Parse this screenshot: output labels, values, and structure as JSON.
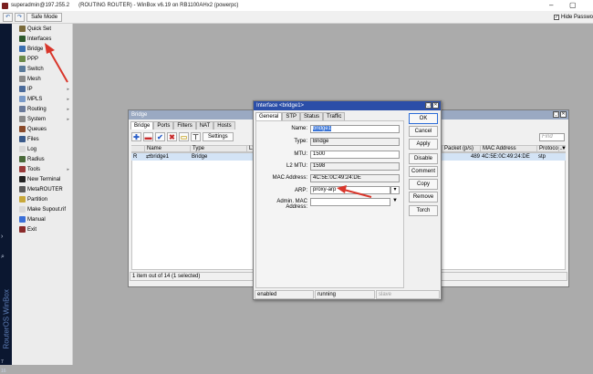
{
  "window": {
    "title": "superadmin@197.255.2      (ROUTING ROUTER) - WinBox v6.19 on RB1100AHx2 (powerpc)",
    "minimize_glyph": "–",
    "restore_glyph": "▢"
  },
  "toolbar": {
    "undo_label": "↶",
    "redo_label": "↷",
    "safe_mode_label": "Safe Mode",
    "hide_passwords_label": "Hide Passwo",
    "hide_passwords_checked": true,
    "check_mark": "✓"
  },
  "taskbar": {
    "brand": "RouterOS WinBox",
    "icons": [
      "›",
      "⌕",
      "Ps",
      "ε",
      "▤"
    ],
    "clock": [
      "7",
      "16"
    ]
  },
  "sidebar": {
    "items": [
      {
        "label": "Quick Set",
        "icon": "quick-set-icon",
        "color": "#7a6a3a",
        "arrow": ""
      },
      {
        "label": "Interfaces",
        "icon": "interfaces-icon",
        "color": "#2d5a2d",
        "arrow": ""
      },
      {
        "label": "Bridge",
        "icon": "bridge-icon",
        "color": "#3a6fb0",
        "arrow": ""
      },
      {
        "label": "PPP",
        "icon": "ppp-icon",
        "color": "#6a8a4a",
        "arrow": ""
      },
      {
        "label": "Switch",
        "icon": "switch-icon",
        "color": "#5a7a9a",
        "arrow": ""
      },
      {
        "label": "Mesh",
        "icon": "mesh-icon",
        "color": "#8a8a8a",
        "arrow": ""
      },
      {
        "label": "IP",
        "icon": "ip-icon",
        "color": "#4a6a9a",
        "arrow": "▸"
      },
      {
        "label": "MPLS",
        "icon": "mpls-icon",
        "color": "#7a9ac8",
        "arrow": "▸"
      },
      {
        "label": "Routing",
        "icon": "routing-icon",
        "color": "#6a7a9a",
        "arrow": "▸"
      },
      {
        "label": "System",
        "icon": "system-icon",
        "color": "#8a8a8a",
        "arrow": "▸"
      },
      {
        "label": "Queues",
        "icon": "queues-icon",
        "color": "#8a4a2a",
        "arrow": ""
      },
      {
        "label": "Files",
        "icon": "files-icon",
        "color": "#3a5a8a",
        "arrow": ""
      },
      {
        "label": "Log",
        "icon": "log-icon",
        "color": "#d8d8d8",
        "arrow": ""
      },
      {
        "label": "Radius",
        "icon": "radius-icon",
        "color": "#4a6a3a",
        "arrow": ""
      },
      {
        "label": "Tools",
        "icon": "tools-icon",
        "color": "#9a3a3a",
        "arrow": "▸"
      },
      {
        "label": "New Terminal",
        "icon": "terminal-icon",
        "color": "#222222",
        "arrow": ""
      },
      {
        "label": "MetaROUTER",
        "icon": "metarouter-icon",
        "color": "#5a5a5a",
        "arrow": ""
      },
      {
        "label": "Partition",
        "icon": "partition-icon",
        "color": "#c8a83a",
        "arrow": ""
      },
      {
        "label": "Make Supout.rif",
        "icon": "supout-icon",
        "color": "#d8d8d8",
        "arrow": ""
      },
      {
        "label": "Manual",
        "icon": "manual-icon",
        "color": "#3a6fd8",
        "arrow": ""
      },
      {
        "label": "Exit",
        "icon": "exit-icon",
        "color": "#8a2a2a",
        "arrow": ""
      }
    ]
  },
  "bridge_window": {
    "title": "Bridge",
    "tabs": [
      "Bridge",
      "Ports",
      "Filters",
      "NAT",
      "Hosts"
    ],
    "buttons": {
      "add": "✚",
      "remove": "▬",
      "enable": "✔",
      "disable": "✖",
      "comment": "▭",
      "filter": "⊤"
    },
    "settings_label": "Settings",
    "find_placeholder": "Find",
    "columns": [
      "Name",
      "Type",
      "L2",
      "Packet (p/s)",
      "MAC Address",
      "Protoco...",
      "▼"
    ],
    "rows": [
      {
        "flag": "R",
        "name": "⇄bridge1",
        "type": "Bridge",
        "packets": "489",
        "mac": "4C:5E:0C:49:24:DE",
        "proto": "stp"
      }
    ],
    "status": "1 item out of 14 (1 selected)"
  },
  "interface_dialog": {
    "title": "Interface <bridge1>",
    "tabs": [
      "General",
      "STP",
      "Status",
      "Traffic"
    ],
    "fields": {
      "name_label": "Name:",
      "name_value": "bridge1",
      "type_label": "Type:",
      "type_value": "Bridge",
      "mtu_label": "MTU:",
      "mtu_value": "1500",
      "l2mtu_label": "L2 MTU:",
      "l2mtu_value": "1598",
      "mac_label": "MAC Address:",
      "mac_value": "4C:5E:0C:49:24:DE",
      "arp_label": "ARP:",
      "arp_value": "proxy-arp",
      "admin_mac_label": "Admin. MAC Address:",
      "admin_mac_value": ""
    },
    "buttons": [
      "OK",
      "Cancel",
      "Apply",
      "Disable",
      "Comment",
      "Copy",
      "Remove",
      "Torch"
    ],
    "status": [
      "enabled",
      "running",
      "slave"
    ]
  },
  "colors": {
    "desktop": "#ababab",
    "annotation_arrow": "#d9362b",
    "selection": "#3874d8"
  }
}
